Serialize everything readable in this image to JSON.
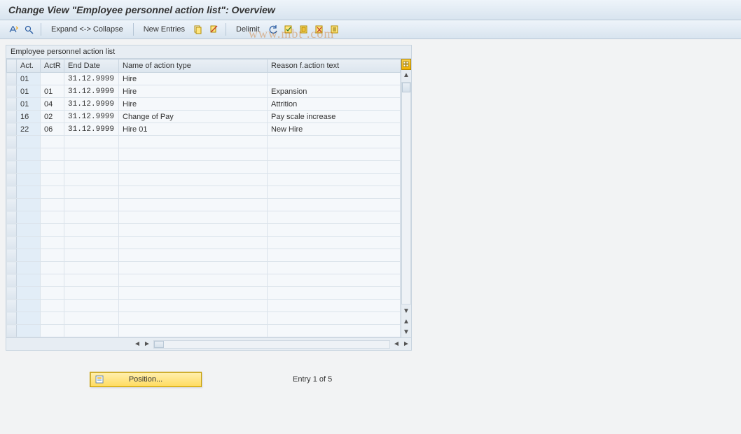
{
  "title": "Change View \"Employee personnel action list\": Overview",
  "toolbar": {
    "expand_collapse_label": "Expand <-> Collapse",
    "new_entries_label": "New Entries",
    "delimit_label": "Delimit"
  },
  "table": {
    "title": "Employee personnel action list",
    "columns": {
      "act": "Act.",
      "actr": "ActR",
      "end_date": "End Date",
      "name": "Name of action type",
      "reason": "Reason f.action text"
    },
    "rows": [
      {
        "act": "01",
        "actr": "",
        "end_date": "31.12.9999",
        "name": "Hire",
        "reason": ""
      },
      {
        "act": "01",
        "actr": "01",
        "end_date": "31.12.9999",
        "name": "Hire",
        "reason": "Expansion"
      },
      {
        "act": "01",
        "actr": "04",
        "end_date": "31.12.9999",
        "name": "Hire",
        "reason": "Attrition"
      },
      {
        "act": "16",
        "actr": "02",
        "end_date": "31.12.9999",
        "name": "Change of Pay",
        "reason": "Pay scale increase"
      },
      {
        "act": "22",
        "actr": "06",
        "end_date": "31.12.9999",
        "name": "Hire 01",
        "reason": "New Hire"
      }
    ],
    "visible_blank_rows": 16
  },
  "footer": {
    "position_label": "Position...",
    "entry_text": "Entry 1 of 5"
  },
  "watermark": "www.mbt  .com"
}
